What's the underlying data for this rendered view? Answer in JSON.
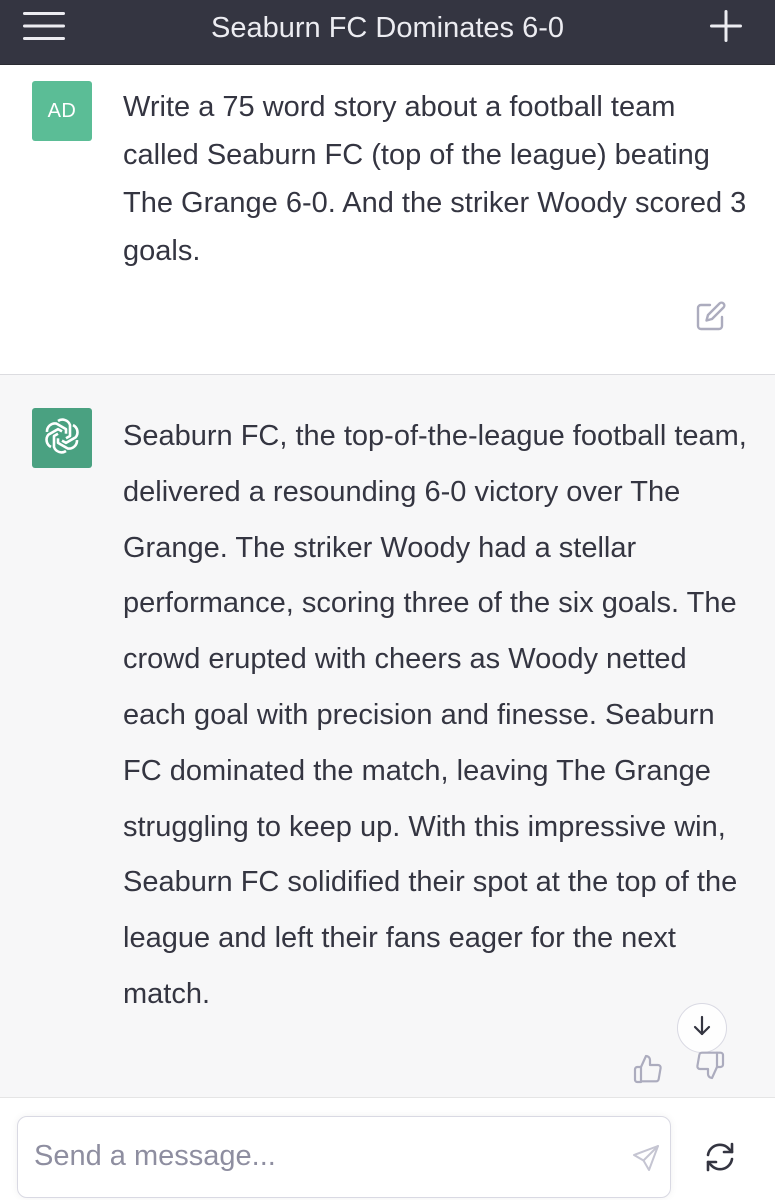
{
  "header": {
    "title": "Seaburn FC Dominates 6-0",
    "menu_icon": "hamburger-menu-icon",
    "new_chat_icon": "plus-icon"
  },
  "conversation": {
    "user_message": {
      "avatar_initials": "AD",
      "avatar_color": "#5bbd96",
      "text": "Write a 75 word story about a football team called Seaburn FC (top of the league) beating The Grange 6-0. And the striker Woody scored 3 goals.",
      "edit_icon": "edit-icon"
    },
    "assistant_message": {
      "avatar_icon": "openai-logo-icon",
      "avatar_color": "#4aa181",
      "text": "Seaburn FC, the top-of-the-league football team, delivered a resounding 6-0 victory over The Grange. The striker Woody had a stellar performance, scoring three of the six goals. The crowd erupted with cheers as Woody netted each goal with precision and finesse. Seaburn FC dominated the match, leaving The Grange struggling to keep up. With this impressive win, Seaburn FC solidified their spot at the top of the league and left their fans eager for the next match.",
      "thumbs_up_icon": "thumbs-up-icon",
      "thumbs_down_icon": "thumbs-down-icon"
    },
    "scroll_down_icon": "arrow-down-icon"
  },
  "composer": {
    "placeholder": "Send a message...",
    "value": "",
    "send_icon": "send-icon",
    "regenerate_icon": "regenerate-icon"
  },
  "colors": {
    "header_bg": "#343541",
    "assistant_bg": "#f7f7f8",
    "text": "#343541"
  }
}
